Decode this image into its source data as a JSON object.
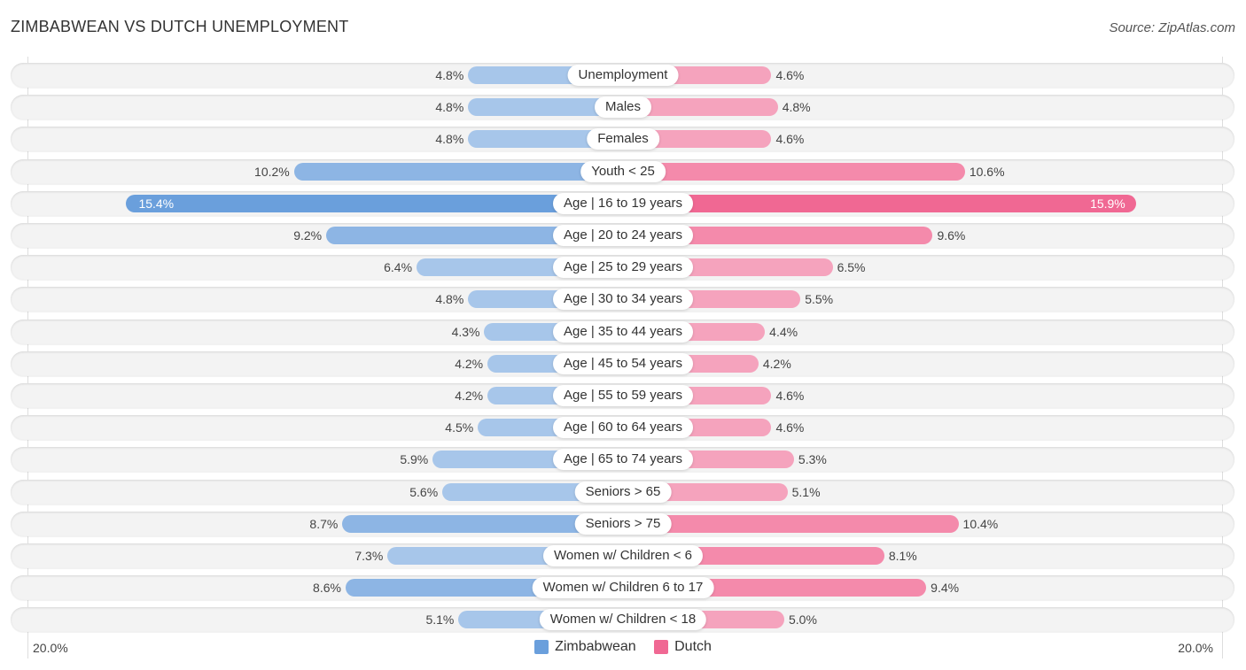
{
  "header": {
    "title": "ZIMBABWEAN VS DUTCH UNEMPLOYMENT",
    "source": "Source: ZipAtlas.com"
  },
  "colors": {
    "zimbabwean": "#6a9fdc",
    "dutch": "#f06893"
  },
  "chart_data": {
    "type": "bar",
    "orientation": "horizontal-diverging",
    "title": "ZIMBABWEAN VS DUTCH UNEMPLOYMENT",
    "xlabel": "",
    "ylabel": "",
    "xlim": [
      -20,
      20
    ],
    "axis_tick_labels": [
      "20.0%",
      "20.0%"
    ],
    "legend_position": "bottom-center",
    "unit": "%",
    "categories": [
      "Unemployment",
      "Males",
      "Females",
      "Youth < 25",
      "Age | 16 to 19 years",
      "Age | 20 to 24 years",
      "Age | 25 to 29 years",
      "Age | 30 to 34 years",
      "Age | 35 to 44 years",
      "Age | 45 to 54 years",
      "Age | 55 to 59 years",
      "Age | 60 to 64 years",
      "Age | 65 to 74 years",
      "Seniors > 65",
      "Seniors > 75",
      "Women w/ Children < 6",
      "Women w/ Children 6 to 17",
      "Women w/ Children < 18"
    ],
    "series": [
      {
        "name": "Zimbabwean",
        "side": "left",
        "values": [
          4.8,
          4.8,
          4.8,
          10.2,
          15.4,
          9.2,
          6.4,
          4.8,
          4.3,
          4.2,
          4.2,
          4.5,
          5.9,
          5.6,
          8.7,
          7.3,
          8.6,
          5.1
        ],
        "labels": [
          "4.8%",
          "4.8%",
          "4.8%",
          "10.2%",
          "15.4%",
          "9.2%",
          "6.4%",
          "4.8%",
          "4.3%",
          "4.2%",
          "4.2%",
          "4.5%",
          "5.9%",
          "5.6%",
          "8.7%",
          "7.3%",
          "8.6%",
          "5.1%"
        ]
      },
      {
        "name": "Dutch",
        "side": "right",
        "values": [
          4.6,
          4.8,
          4.6,
          10.6,
          15.9,
          9.6,
          6.5,
          5.5,
          4.4,
          4.2,
          4.6,
          4.6,
          5.3,
          5.1,
          10.4,
          8.1,
          9.4,
          5.0
        ],
        "labels": [
          "4.6%",
          "4.8%",
          "4.6%",
          "10.6%",
          "15.9%",
          "9.6%",
          "6.5%",
          "5.5%",
          "4.4%",
          "4.2%",
          "4.6%",
          "4.6%",
          "5.3%",
          "5.1%",
          "10.4%",
          "8.1%",
          "9.4%",
          "5.0%"
        ]
      }
    ]
  },
  "legend": {
    "items": [
      {
        "label": "Zimbabwean"
      },
      {
        "label": "Dutch"
      }
    ]
  },
  "axis": {
    "left_label": "20.0%",
    "right_label": "20.0%"
  }
}
